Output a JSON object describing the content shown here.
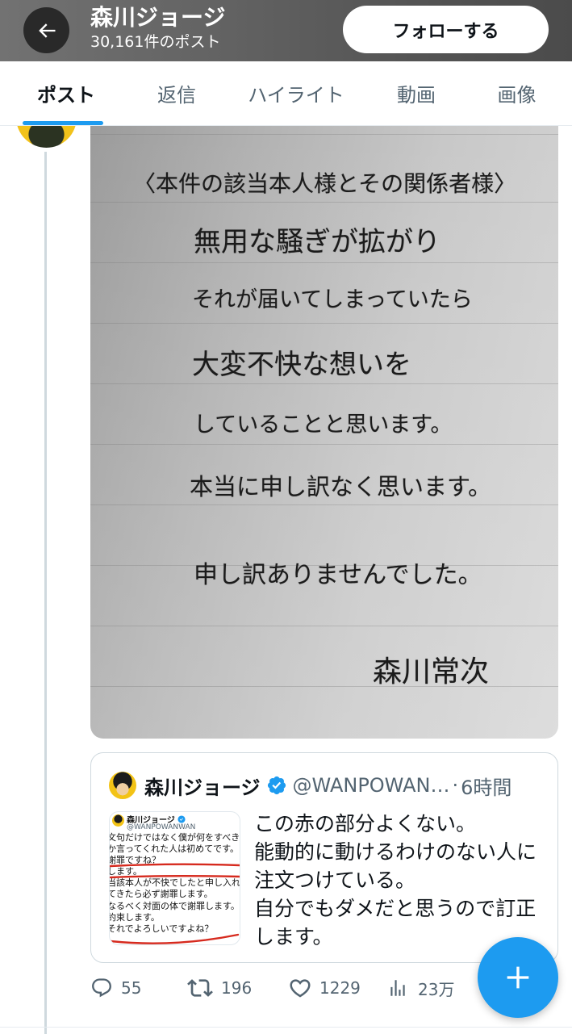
{
  "header": {
    "back_icon": "arrow-left-icon",
    "name": "森川ジョージ",
    "post_count": "30,161件のポスト",
    "follow_label": "フォローする"
  },
  "tabs": [
    {
      "label": "ポスト",
      "active": true
    },
    {
      "label": "返信",
      "active": false
    },
    {
      "label": "ハイライト",
      "active": false
    },
    {
      "label": "動画",
      "active": false
    },
    {
      "label": "画像",
      "active": false
    }
  ],
  "post": {
    "photo": {
      "lines": [
        "〈本件の該当本人様とその関係者様〉",
        "無用な騒ぎが拡がり",
        "それが届いてしまっていたら",
        "大変不快な想いを",
        "していることと思います。",
        "本当に申し訳なく思います。",
        "申し訳ありませんでした。"
      ],
      "signature": "森川常次"
    },
    "quote": {
      "author_name": "森川ジョージ",
      "verified_icon": "verified-badge-icon",
      "handle": "@WANPOWAN…",
      "separator": "·",
      "time": "6時間",
      "text_lines": [
        "この赤の部分よくない。",
        "能動的に動けるわけのない人に",
        "注文つけている。",
        "自分でもダメだと思うので訂正",
        "します。"
      ],
      "thumbnail": {
        "author_name": "森川ジョージ",
        "handle": "@WANPOWANWAN",
        "lines": [
          "文句だけではなく僕が何をすべき",
          "か言ってくれた人は初めてです。",
          "謝罪ですね？",
          "します。",
          "当該本人が不快でしたと申し入れ",
          "てきたら必ず謝罪します。",
          "なるべく対面の体で謝罪します。",
          "約束します。",
          "それでよろしいですよね？"
        ]
      }
    },
    "actions": {
      "replies": {
        "icon": "reply-icon",
        "count": "55"
      },
      "reposts": {
        "icon": "repost-icon",
        "count": "196"
      },
      "likes": {
        "icon": "heart-icon",
        "count": "1229"
      },
      "views": {
        "icon": "views-icon",
        "count": "23万"
      }
    }
  },
  "fab": {
    "icon": "plus-icon"
  },
  "colors": {
    "accent": "#1d9bf0",
    "text": "#0f1419",
    "muted": "#536471",
    "divider": "#cfd9de",
    "banner": "#5e5e5e",
    "annotation_red": "#d62a1e"
  }
}
